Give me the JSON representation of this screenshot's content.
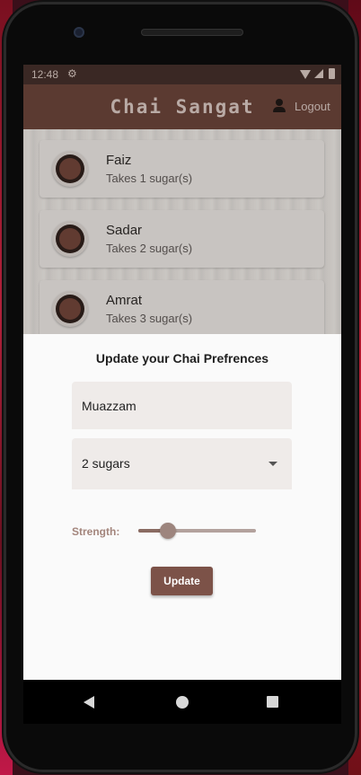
{
  "status_bar": {
    "time": "12:48",
    "settings_icon": "gear-icon",
    "icons": [
      "wifi-icon",
      "signal-icon",
      "battery-icon"
    ]
  },
  "app_bar": {
    "title": "Chai Sangat",
    "logout_label": "Logout",
    "logout_icon": "person-icon"
  },
  "friends": [
    {
      "name": "Faiz",
      "sugar": "Takes 1 sugar(s)"
    },
    {
      "name": "Sadar",
      "sugar": "Takes 2 sugar(s)"
    },
    {
      "name": "Amrat",
      "sugar": "Takes 3 sugar(s)"
    }
  ],
  "sheet": {
    "heading": "Update your Chai Prefrences",
    "name_value": "Muazzam",
    "sugar_selected": "2 sugars",
    "strength_label": "Strength:",
    "strength_value": 0.25,
    "update_label": "Update"
  },
  "colors": {
    "brand": "#5b3a31",
    "button": "#7c5248",
    "slider": "#9d857e"
  }
}
